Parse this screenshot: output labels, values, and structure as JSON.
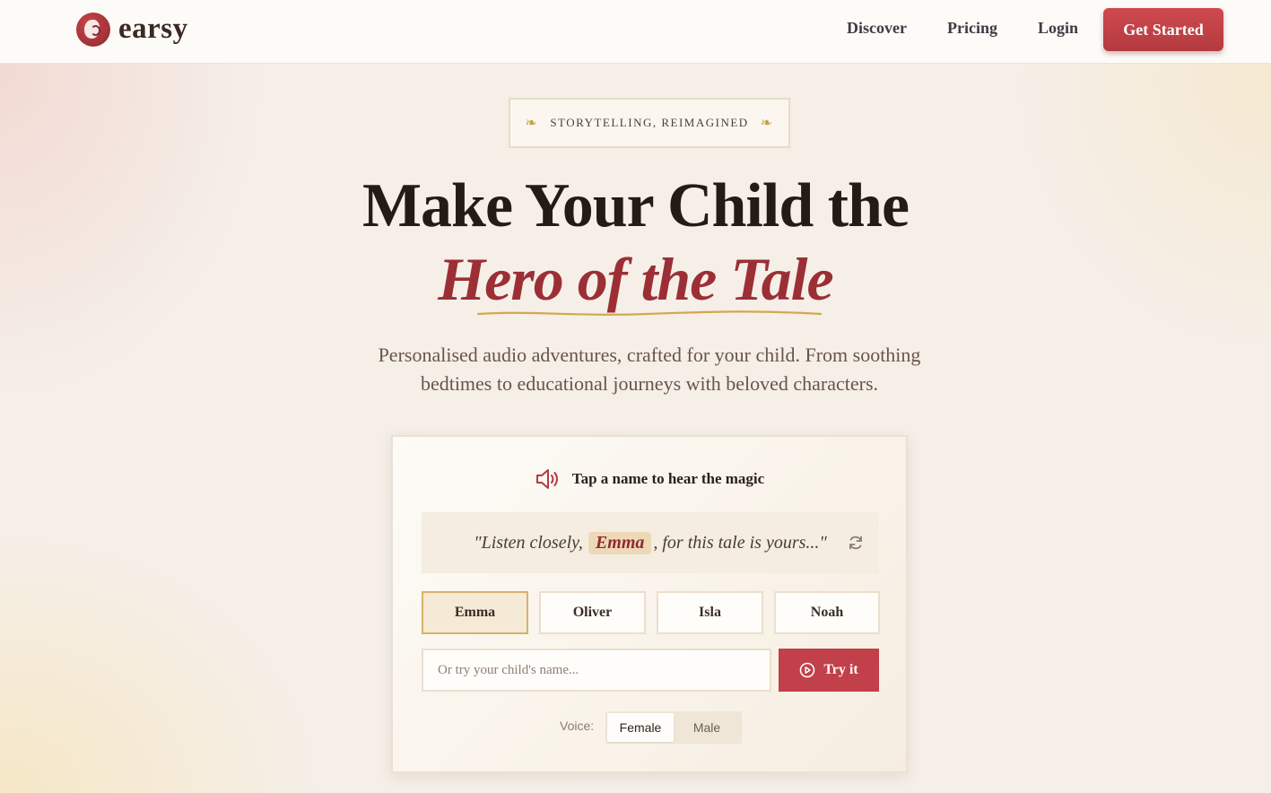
{
  "nav": {
    "logo": "earsy",
    "links": [
      "Discover",
      "Pricing",
      "Login"
    ],
    "cta": "Get Started"
  },
  "hero": {
    "badge": "STORYTELLING, REIMAGINED",
    "badge_ornament": "❧",
    "title_line1": "Make Your Child the",
    "title_line2": "Hero of the Tale",
    "subtitle": "Personalised audio adventures, crafted for your child. From soothing bedtimes to educational journeys with beloved characters."
  },
  "demo": {
    "heading": "Tap a name to hear the magic",
    "quote_before": "\"Listen closely,",
    "quote_name": "Emma",
    "quote_after": ", for this tale is yours...\"",
    "names": [
      "Emma",
      "Oliver",
      "Isla",
      "Noah"
    ],
    "selected_name": "Emma",
    "input_placeholder": "Or try your child's name...",
    "input_value": "",
    "try_label": "Try it",
    "voice_label": "Voice:",
    "voice_options": [
      "Female",
      "Male"
    ],
    "voice_selected": "Female"
  },
  "colors": {
    "brand_red": "#c1404a",
    "accent_gold": "#d6b26a",
    "title_red": "#9b2f35"
  }
}
